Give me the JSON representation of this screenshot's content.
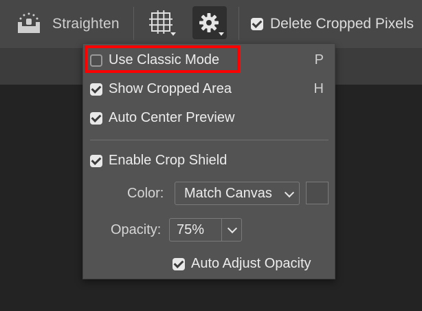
{
  "toolbar": {
    "straighten_label": "Straighten",
    "delete_cropped_label": "Delete Cropped Pixels",
    "delete_cropped_checked": true,
    "icons": [
      "straighten-icon",
      "grid-overlay-icon",
      "gear-icon"
    ]
  },
  "menu": {
    "items": [
      {
        "label": "Use Classic Mode",
        "checked": false,
        "shortcut": "P"
      },
      {
        "label": "Show Cropped Area",
        "checked": true,
        "shortcut": "H"
      },
      {
        "label": "Auto Center Preview",
        "checked": true,
        "shortcut": ""
      },
      {
        "label": "Enable Crop Shield",
        "checked": true,
        "shortcut": ""
      }
    ],
    "color_label": "Color:",
    "color_value": "Match Canvas",
    "opacity_label": "Opacity:",
    "opacity_value": "75%",
    "auto_adjust_label": "Auto Adjust Opacity",
    "auto_adjust_checked": true
  },
  "colors": {
    "highlight": "#ff0000",
    "toolbar_bg": "#474747",
    "menu_bg": "#535353",
    "canvas_bg": "#232323"
  }
}
